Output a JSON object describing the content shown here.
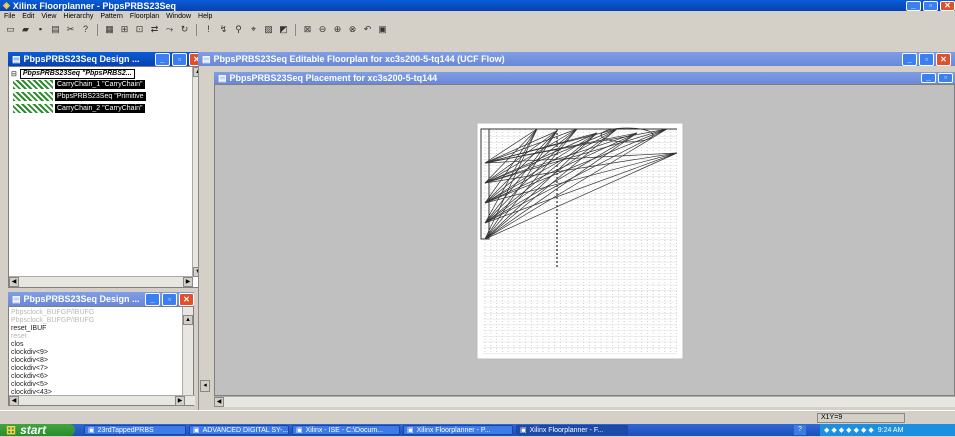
{
  "app": {
    "title": "Xilinx Floorplanner - PbpsPRBS23Seq",
    "menu": [
      "File",
      "Edit",
      "View",
      "Hierarchy",
      "Pattern",
      "Floorplan",
      "Window",
      "Help"
    ]
  },
  "toolbar": {
    "icons": [
      "new-icon",
      "open-icon",
      "save-icon",
      "print-icon",
      "cut-icon",
      "help-pointer-icon",
      "grid-icon",
      "hierarchy-icon",
      "place-icon",
      "move-icon",
      "route-icon",
      "cycle-icon",
      "constraint-icon",
      "probe-icon",
      "find-icon",
      "select-icon",
      "pattern-icon",
      "assign-icon",
      "zoom-fit-icon",
      "zoom-out-icon",
      "zoom-in-icon",
      "zoom-area-icon",
      "zoom-prev-icon",
      "capture-icon"
    ]
  },
  "design_hierarchy": {
    "title": "PbpsPRBS23Seq Design ...",
    "items": [
      {
        "label": "PbpsPRBS23Seq \"PbpsPRBS2..."
      },
      {
        "label": "CarryChain_1 \"CarryChain\""
      },
      {
        "label": "PbpsPRBS23Seq \"Primitive"
      },
      {
        "label": "CarryChain_2 \"CarryChain\""
      }
    ]
  },
  "design_nets": {
    "title": "PbpsPRBS23Seq Design ...",
    "items": [
      {
        "label": "Pbpsclock_BUFGP/IBUFG",
        "dim": true
      },
      {
        "label": "Pbpsclock_BUFGP/IBUFG",
        "dim": true
      },
      {
        "label": "reset_IBUF",
        "dim": false
      },
      {
        "label": "reset",
        "dim": true
      },
      {
        "label": "clos",
        "dim": false
      },
      {
        "label": "clockdiv<9>",
        "dim": false
      },
      {
        "label": "clockdiv<8>",
        "dim": false
      },
      {
        "label": "clockdiv<7>",
        "dim": false
      },
      {
        "label": "clockdiv<6>",
        "dim": false
      },
      {
        "label": "clockdiv<5>",
        "dim": false
      },
      {
        "label": "clockdiv<43>",
        "dim": false
      },
      {
        "label": "clockdiv<43>",
        "dim": false
      }
    ]
  },
  "editable_floorplan": {
    "title": "PbpsPRBS23Seq Editable Floorplan for xc3s200-5-tq144  (UCF Flow)"
  },
  "placement": {
    "title": "PbpsPRBS23Seq Placement for xc3s200-5-tq144"
  },
  "status": {
    "coords": "X1Y=9"
  },
  "taskbar": {
    "start_label": "start",
    "items": [
      {
        "label": "23rdTappedPRBS",
        "icon": "folder-icon"
      },
      {
        "label": "ADVANCED DIGITAL SY-...",
        "icon": "document-icon"
      },
      {
        "label": "Xilinx - ISE - C:\\Docum...",
        "icon": "ise-icon"
      },
      {
        "label": "Xilinx Floorplanner - P...",
        "icon": "floorplanner-icon"
      },
      {
        "label": "Xilinx Floorplanner - F...",
        "icon": "floorplanner-icon"
      }
    ],
    "clock": "9:24 AM"
  }
}
